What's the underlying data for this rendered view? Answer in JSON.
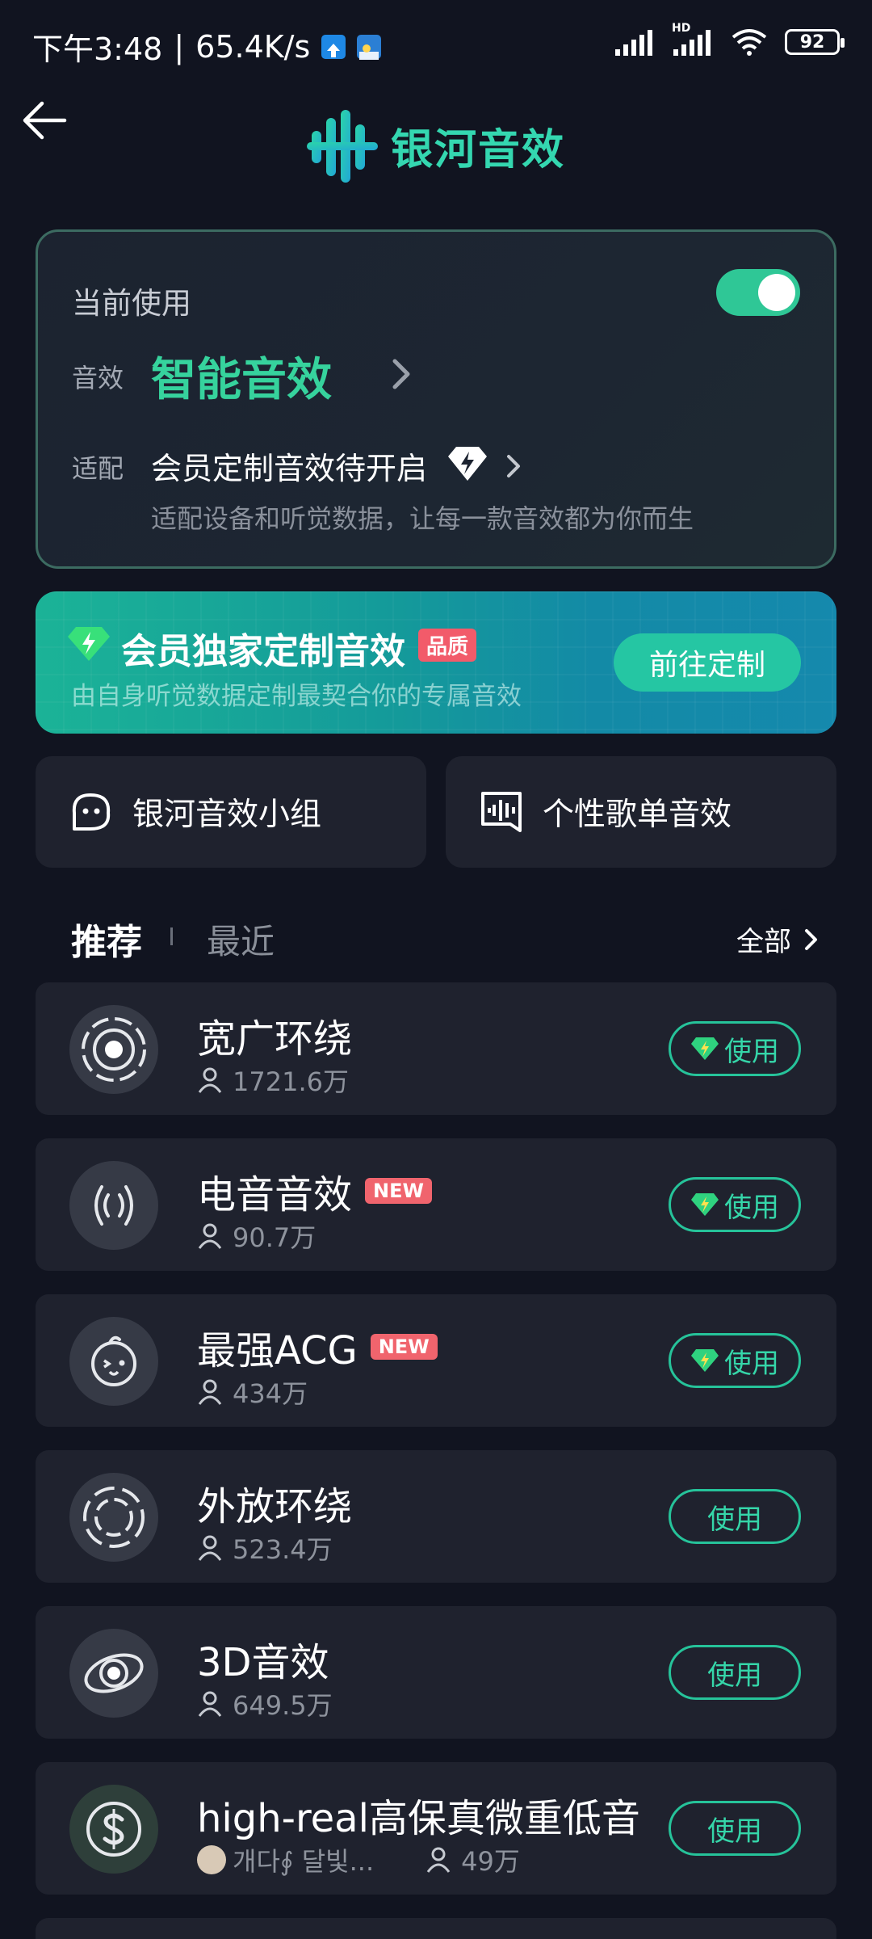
{
  "status_bar": {
    "time": "下午3:48",
    "separator": "|",
    "speed": "65.4K/s",
    "signal_label": "HD",
    "battery": "92"
  },
  "header": {
    "title": "银河音效"
  },
  "current": {
    "label": "当前使用",
    "toggle_on": true,
    "effect_key": "音效",
    "effect_value": "智能音效",
    "adapt_key": "适配",
    "adapt_value": "会员定制音效待开启",
    "adapt_desc": "适配设备和听觉数据，让每一款音效都为你而生"
  },
  "member_banner": {
    "title": "会员独家定制音效",
    "tag": "品质",
    "subtitle": "由自身听觉数据定制最契合你的专属音效",
    "button": "前往定制"
  },
  "quick": [
    {
      "label": "银河音效小组",
      "icon": "group-face-icon"
    },
    {
      "label": "个性歌单音效",
      "icon": "playlist-wave-icon"
    }
  ],
  "tabs": {
    "active": "推荐",
    "inactive": "最近",
    "all": "全部"
  },
  "effects": [
    {
      "name": "宽广环绕",
      "users": "1721.6万",
      "new": false,
      "premium": true,
      "button": "使用"
    },
    {
      "name": "电音音效",
      "users": "90.7万",
      "new": true,
      "new_label": "NEW",
      "premium": true,
      "button": "使用"
    },
    {
      "name": "最强ACG",
      "users": "434万",
      "new": true,
      "new_label": "NEW",
      "premium": true,
      "button": "使用"
    },
    {
      "name": "外放环绕",
      "users": "523.4万",
      "new": false,
      "premium": false,
      "button": "使用"
    },
    {
      "name": "3D音效",
      "users": "649.5万",
      "new": false,
      "premium": false,
      "button": "使用"
    },
    {
      "name": "high-real高保真微重低音",
      "author": "개다∮ 달빛...",
      "users": "49万",
      "new": false,
      "premium": false,
      "button": "使用"
    }
  ],
  "colors": {
    "accent": "#36d39d",
    "background": "#111420",
    "card": "#1f222e",
    "new_badge": "#f0646d"
  }
}
